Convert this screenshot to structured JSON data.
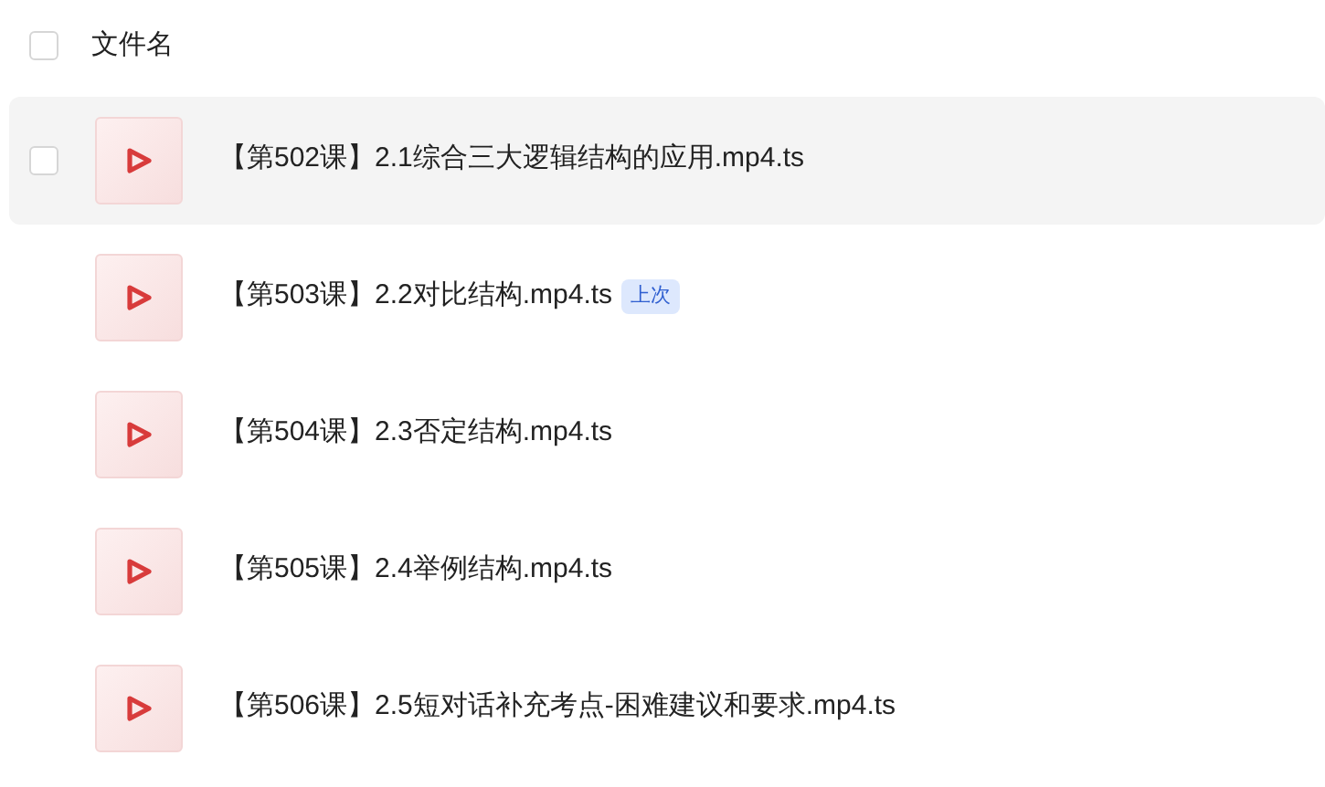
{
  "header": {
    "label": "文件名",
    "checked": false
  },
  "files": [
    {
      "name": "【第502课】2.1综合三大逻辑结构的应用.mp4.ts",
      "hovered": true,
      "checked": false
    },
    {
      "name": "【第503课】2.2对比结构.mp4.ts",
      "hovered": false,
      "checked": false,
      "badge": "上次"
    },
    {
      "name": "【第504课】2.3否定结构.mp4.ts",
      "hovered": false,
      "checked": false
    },
    {
      "name": "【第505课】2.4举例结构.mp4.ts",
      "hovered": false,
      "checked": false
    },
    {
      "name": "【第506课】2.5短对话补充考点-困难建议和要求.mp4.ts",
      "hovered": false,
      "checked": false
    }
  ]
}
